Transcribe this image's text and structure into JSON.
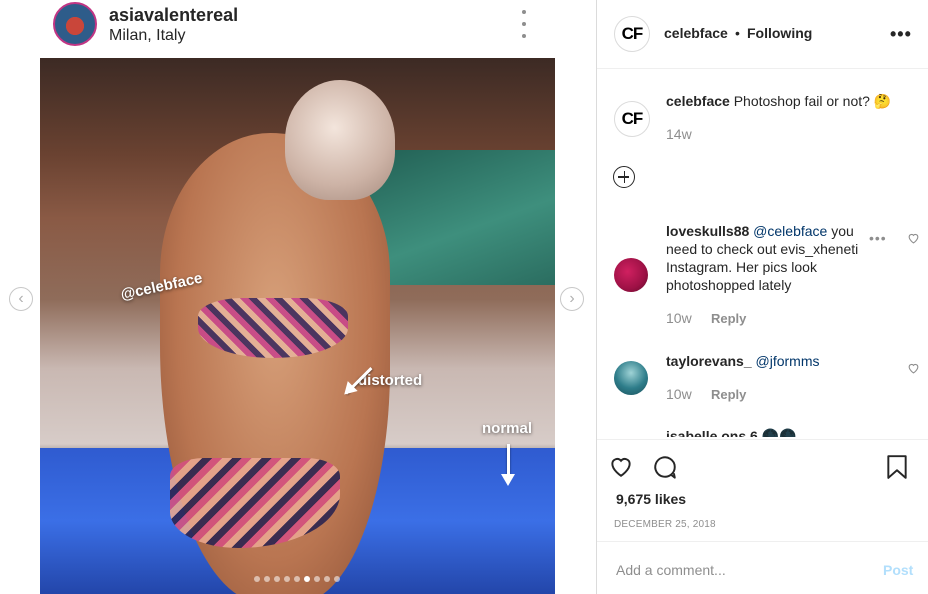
{
  "embedded_post": {
    "username": "asiavalentereal",
    "location": "Milan, Italy",
    "overlay": {
      "watermark": "@celebface",
      "label_distorted": "distorted",
      "label_normal": "normal"
    },
    "carousel": {
      "dot_count": 9,
      "active_index": 5,
      "prev_icon": "chevron-left-icon",
      "next_icon": "chevron-right-icon"
    }
  },
  "post_header": {
    "logo_text": "CF",
    "username": "celebface",
    "separator": "•",
    "follow_status": "Following",
    "more_icon": "more-options-icon",
    "more_glyph": "•••"
  },
  "caption": {
    "logo_text": "CF",
    "username": "celebface",
    "text": "Photoshop fail or not? 🤔",
    "time": "14w"
  },
  "comments": [
    {
      "username": "loveskulls88",
      "mention": "@celebface",
      "text": "you need to check out evis_xheneti Instagram. Her pics look photoshopped lately",
      "time": "10w",
      "reply_label": "Reply",
      "more_glyph": "•••"
    },
    {
      "username": "taylorevans_",
      "mention": "@jformms",
      "text": "",
      "time": "10w",
      "reply_label": "Reply"
    }
  ],
  "partial_comment": "isabelle.ons.6 🌑🌑",
  "actions": {
    "like_icon": "heart-icon",
    "comment_icon": "comment-bubble-icon",
    "save_icon": "bookmark-icon"
  },
  "likes": "9,675 likes",
  "date": "DECEMBER 25, 2018",
  "comment_box": {
    "placeholder": "Add a comment...",
    "post_label": "Post"
  },
  "colors": {
    "text": "#262626",
    "muted": "#8e8e8e",
    "link": "#003569",
    "post_disabled": "#b2dffc",
    "divider": "#efefef"
  }
}
